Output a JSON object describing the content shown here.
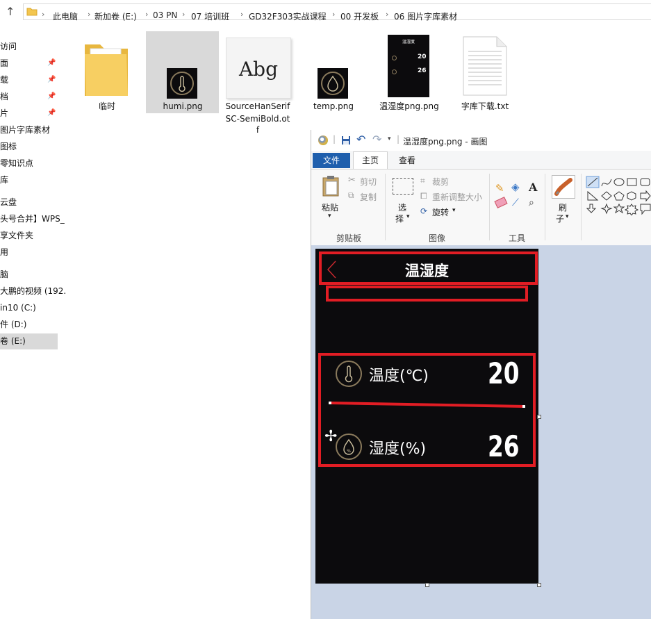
{
  "explorer": {
    "breadcrumb": [
      "此电脑",
      "新加卷 (E:)",
      "03 PN",
      "07 培训班",
      "GD32F303实战课程",
      "00 开发板",
      "06 图片字库素材"
    ],
    "nav_items": [
      "访问",
      "面",
      "载",
      "档",
      "片",
      "图片字库素材",
      "图标",
      "零知识点",
      "库",
      "云盘",
      "头号合并】WPS_",
      "享文件夹",
      "用",
      "脑",
      "大鹏的视频 (192.",
      "in10 (C:)",
      "件 (D:)",
      "卷 (E:)"
    ],
    "files": [
      {
        "name": "临时",
        "icon": "folder-icon"
      },
      {
        "name": "humi.png",
        "icon": "image-thumbnail"
      },
      {
        "name_line1": "SourceHanSerif",
        "name_line2": "SC-SemiBold.ot",
        "name_line3": "f",
        "preview": "Abg",
        "icon": "font-file-icon"
      },
      {
        "name": "temp.png",
        "icon": "image-thumbnail"
      },
      {
        "name": "温湿度png.png",
        "icon": "image-thumbnail",
        "mini_title": "温湿度",
        "mini_t": "20",
        "mini_h": "26"
      },
      {
        "name": "字库下载.txt",
        "icon": "text-file-icon"
      }
    ]
  },
  "paint": {
    "title": "温湿度png.png - 画图",
    "tabs": {
      "file": "文件",
      "home": "主页",
      "view": "查看"
    },
    "clipboard": {
      "paste": "粘贴",
      "cut": "剪切",
      "copy": "复制",
      "group": "剪贴板"
    },
    "image": {
      "select_1": "选",
      "select_2": "择",
      "crop": "裁剪",
      "resize": "重新调整大小",
      "rotate": "旋转",
      "group": "图像"
    },
    "tools": {
      "group": "工具",
      "text_tool": "A"
    },
    "brush": {
      "label_1": "刷",
      "label_2": "子"
    }
  },
  "screen": {
    "title": "温湿度",
    "temp_label": "温度(℃)",
    "temp_value": "20",
    "humi_label": "湿度(%)",
    "humi_value": "26",
    "accent": "#e21d24",
    "icon_ring": "#8a7a5c"
  }
}
